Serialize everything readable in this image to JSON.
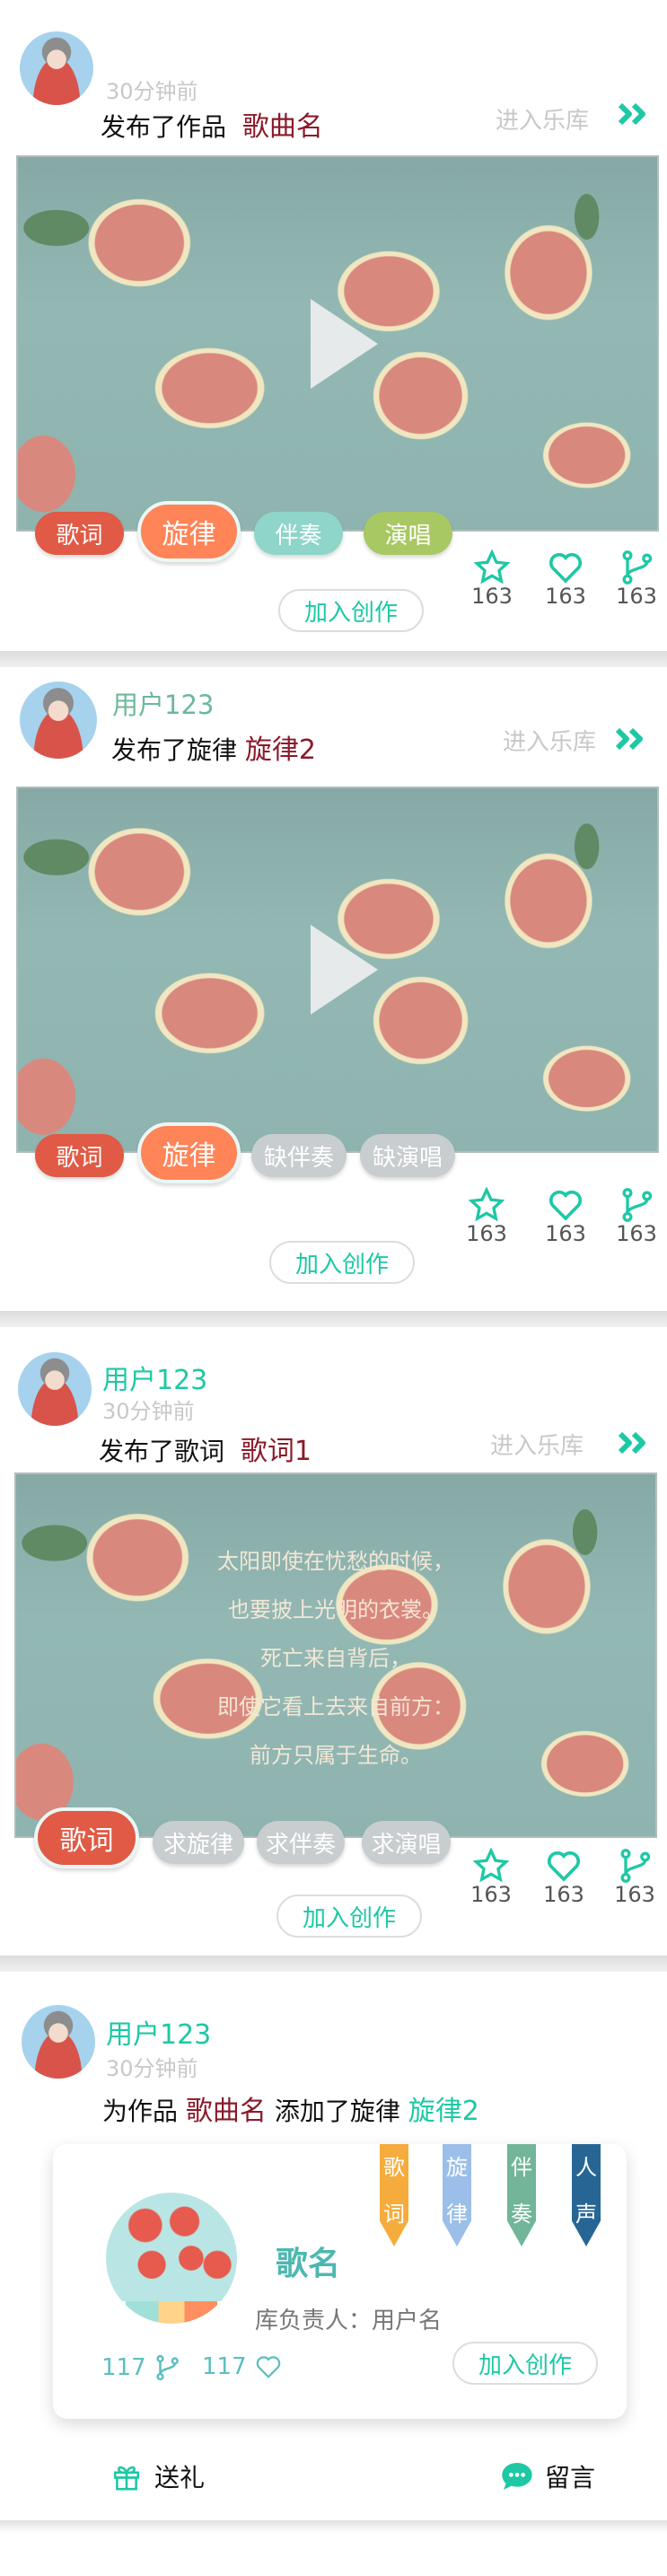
{
  "common": {
    "enter_library": "进入乐库",
    "join": "加入创作",
    "time": "30分钟前",
    "username": "用户123"
  },
  "cards": [
    {
      "time": "30分钟前",
      "action": "发布了作品",
      "target": "歌曲名",
      "tags": [
        "歌词",
        "旋律",
        "伴奏",
        "演唱"
      ],
      "stats": {
        "favorites": "163",
        "likes": "163",
        "forks": "163"
      }
    },
    {
      "username": "用户123",
      "action": "发布了旋律",
      "target": "旋律2",
      "tags": [
        "歌词",
        "旋律",
        "缺伴奏",
        "缺演唱"
      ],
      "stats": {
        "favorites": "163",
        "likes": "163",
        "forks": "163"
      }
    },
    {
      "username": "用户123",
      "time": "30分钟前",
      "action": "发布了歌词",
      "target": "歌词1",
      "lyrics": [
        "太阳即使在忧愁的时候，",
        "也要披上光明的衣裳。",
        "死亡来自背后，",
        "即使它看上去来自前方：",
        "前方只属于生命。"
      ],
      "tags": [
        "歌词",
        "求旋律",
        "求伴奏",
        "求演唱"
      ],
      "stats": {
        "favorites": "163",
        "likes": "163",
        "forks": "163"
      }
    },
    {
      "username": "用户123",
      "time": "30分钟前",
      "action_prefix": "为作品",
      "target": "歌曲名",
      "action_mid": "添加了旋律",
      "target2": "旋律2",
      "work": {
        "ribbons": [
          "歌词",
          "旋律",
          "伴奏",
          "人声"
        ],
        "title": "歌名",
        "owner_label": "库负责人：",
        "owner": "用户名",
        "forks": "117",
        "likes": "117"
      },
      "footer": {
        "gift": "送礼",
        "comment": "留言"
      }
    }
  ],
  "colors": {
    "teal": "#1ec8a5",
    "red": "#8b1a2a",
    "tag_lyrics": "#e05a45",
    "tag_melody": "#ff8458",
    "tag_accomp": "#8fd5c9",
    "tag_vocal": "#a8c863",
    "tag_missing": "#c8cdd0"
  }
}
